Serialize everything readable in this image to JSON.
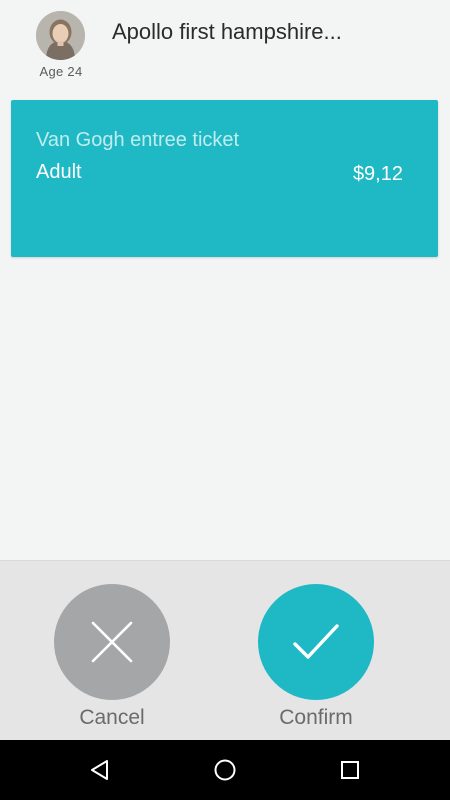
{
  "profile": {
    "avatar_icon": "person-avatar-icon",
    "age_label": "Age 24"
  },
  "header": {
    "merchant_name": "Apollo first hampshire..."
  },
  "ticket": {
    "name": "Van Gogh entree ticket",
    "type": "Adult",
    "price": "$9,12"
  },
  "actions": {
    "cancel": {
      "label": "Cancel",
      "icon": "close-icon"
    },
    "confirm": {
      "label": "Confirm",
      "icon": "checkmark-icon"
    }
  },
  "system_nav": {
    "back_icon": "back-triangle-icon",
    "home_icon": "home-circle-icon",
    "recents_icon": "recents-square-icon"
  },
  "colors": {
    "accent": "#1fb9c5",
    "cancel_grey": "#a5a6a8",
    "background": "#f3f4f4",
    "panel": "#e5e5e5"
  }
}
